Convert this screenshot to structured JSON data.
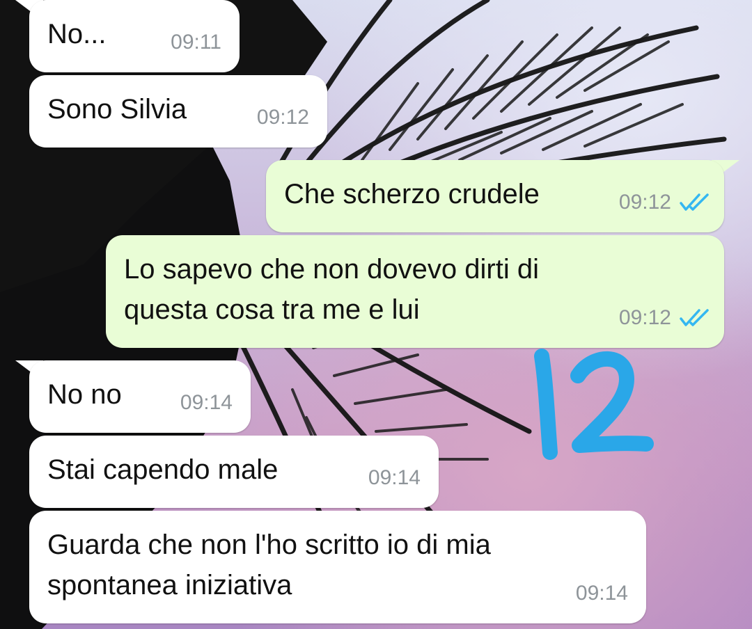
{
  "messages": [
    {
      "direction": "incoming",
      "text": "No...",
      "time": "09:11"
    },
    {
      "direction": "incoming",
      "text": "Sono Silvia",
      "time": "09:12"
    },
    {
      "direction": "outgoing",
      "text": "Che scherzo crudele",
      "time": "09:12",
      "status": "read"
    },
    {
      "direction": "outgoing",
      "lines": [
        "Lo sapevo che non dovevo dirti di",
        "questa cosa tra me e lui"
      ],
      "time": "09:12",
      "status": "read"
    },
    {
      "direction": "incoming",
      "text": "No no",
      "time": "09:14"
    },
    {
      "direction": "incoming",
      "text": "Stai capendo male",
      "time": "09:14"
    },
    {
      "direction": "incoming",
      "lines": [
        "Guarda che non l'ho scritto io di mia",
        "spontanea iniziativa"
      ],
      "time": "09:14"
    }
  ],
  "annotation": {
    "text": "12",
    "color": "#2aa7e8"
  },
  "colors": {
    "incoming_bubble": "#ffffff",
    "outgoing_bubble": "#e9fdd6",
    "read_tick": "#34b7f1",
    "timestamp": "#8e9499"
  },
  "icons": {
    "read_receipt": "double-check-icon"
  }
}
